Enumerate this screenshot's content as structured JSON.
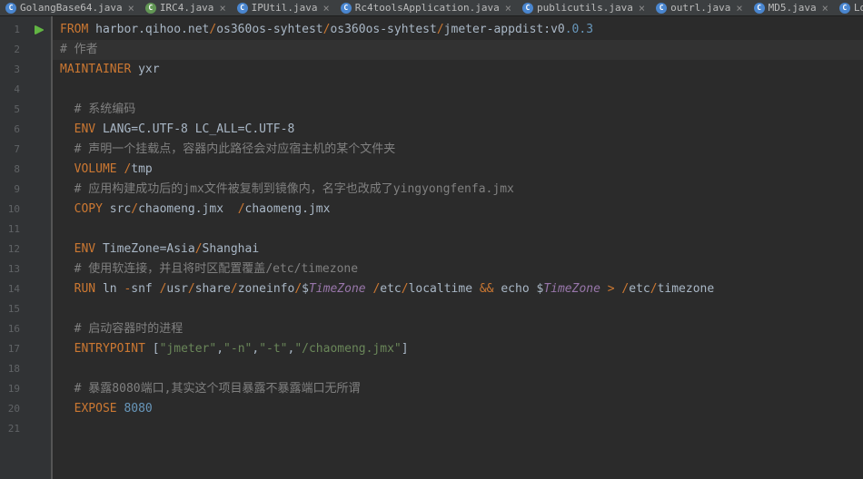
{
  "tabs": [
    {
      "label": "GolangBase64.java",
      "iconClass": "icon-java"
    },
    {
      "label": "IRC4.java",
      "iconClass": "icon-java-green"
    },
    {
      "label": "IPUtil.java",
      "iconClass": "icon-java"
    },
    {
      "label": "Rc4toolsApplication.java",
      "iconClass": "icon-java"
    },
    {
      "label": "publicutils.java",
      "iconClass": "icon-java"
    },
    {
      "label": "outrl.java",
      "iconClass": "icon-java"
    },
    {
      "label": "MD5.java",
      "iconClass": "icon-java"
    },
    {
      "label": "Log",
      "iconClass": "icon-java"
    }
  ],
  "tab_close": "×",
  "tab_icon_letter": "C",
  "line_numbers": [
    "1",
    "2",
    "3",
    "4",
    "5",
    "6",
    "7",
    "8",
    "9",
    "10",
    "11",
    "12",
    "13",
    "14",
    "15",
    "16",
    "17",
    "18",
    "19",
    "20",
    "21"
  ],
  "tokens": {
    "from": "FROM",
    "maintainer": "MAINTAINER",
    "env": "ENV",
    "volume": "VOLUME",
    "copy": "COPY",
    "run": "RUN",
    "entrypoint": "ENTRYPOINT",
    "expose": "EXPOSE",
    "and": "&&",
    "gt": ">",
    "slash": "/",
    "dash": "-",
    "dollar": "$",
    "lbrak": "[",
    "rbrak": "]",
    "comma": ",",
    "colon": ":"
  },
  "code": {
    "l1_host": "harbor.qihoo.net",
    "l1_seg1": "os360os-syhtest",
    "l1_seg2": "os360os-syhtest",
    "l1_seg3": "jmeter-appdist:v0",
    "l1_ver": ".0.3",
    "l2": "# 作者",
    "l3_val": "yxr",
    "l5": "# 系统编码",
    "l6_val": "LANG=C.UTF-8 LC_ALL=C.UTF-8",
    "l7": "# 声明一个挂载点，容器内此路径会对应宿主机的某个文件夹",
    "l8_val": "tmp",
    "l9": "# 应用构建成功后的jmx文件被复制到镜像内，名字也改成了yingyongfenfa.jmx",
    "l10_src": "src",
    "l10_f1": "chaomeng.jmx  ",
    "l10_f2": "chaomeng.jmx",
    "l12_val": "TimeZone=Asia",
    "l12_val2": "Shanghai",
    "l13a": "# 使用软连接，并且将时区配置覆盖",
    "l13b": "/etc/timezone",
    "l14_ln": "ln ",
    "l14_snf": "snf ",
    "l14_usr": "usr",
    "l14_share": "share",
    "l14_zone": "zoneinfo",
    "l14_tz": "TimeZone",
    "l14_etc": "etc",
    "l14_lt": "localtime ",
    "l14_echo": " echo ",
    "l14_timezone": "timezone",
    "l16": "# 启动容器时的进程",
    "l17_s1": "\"jmeter\"",
    "l17_s2": "\"-n\"",
    "l17_s3": "\"-t\"",
    "l17_s4": "\"/chaomeng.jmx\"",
    "l19": "# 暴露8080端口,其实这个项目暴露不暴露端口无所谓",
    "l20_port": "8080"
  }
}
